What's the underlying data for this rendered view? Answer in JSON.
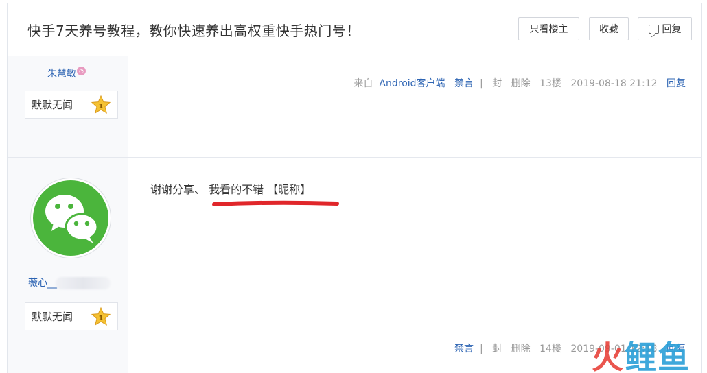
{
  "header": {
    "title": "快手7天养号教程，教你快速养出高权重快手热门号！",
    "only_op_label": "只看楼主",
    "collect_label": "收藏",
    "reply_label": "回复"
  },
  "posts": [
    {
      "username": "朱慧敏",
      "level_name": "默默无闻",
      "level_num": "1",
      "source_prefix": "来自",
      "source_name": "Android客户端",
      "ban": "禁言",
      "block": "封",
      "delete": "删除",
      "floor": "13楼",
      "time": "2019-08-18 21:12",
      "reply": "回复"
    },
    {
      "username": "薇心__",
      "level_name": "默默无闻",
      "level_num": "1",
      "content": "谢谢分享、 我看的不错 【昵称】",
      "ban": "禁言",
      "block": "封",
      "delete": "删除",
      "floor": "14楼",
      "time": "2019-09-01 12:18",
      "reply": "回复"
    }
  ],
  "watermark": {
    "part1": "火",
    "part2": "鲤鱼"
  },
  "colors": {
    "link": "#2d64b3",
    "accent_red": "#e8433b",
    "wechat_green": "#4bb53c",
    "star": "#f5c233"
  },
  "icons": [
    "reply-icon",
    "vip-icon",
    "level-star-icon",
    "wechat-avatar-icon"
  ]
}
